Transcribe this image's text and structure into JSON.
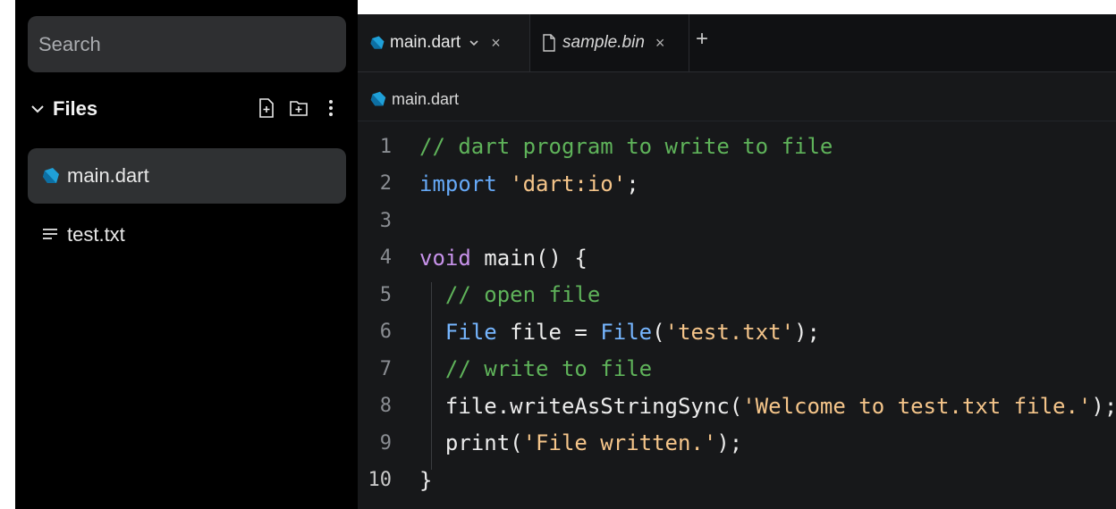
{
  "colors": {
    "sidebar_bg": "#000000",
    "editor_bg": "#17181a",
    "dart_icon": "#1fa0d8",
    "comment": "#5fb35a",
    "keyword": "#c792ea",
    "string": "#f5c58a",
    "type": "#76b6ff"
  },
  "sidebar": {
    "search_placeholder": "Search",
    "files_title": "Files",
    "actions": [
      "new-file-icon",
      "new-folder-icon",
      "more-vertical-icon"
    ],
    "files": [
      {
        "name": "main.dart",
        "icon": "dart-icon",
        "active": true
      },
      {
        "name": "test.txt",
        "icon": "text-file-icon",
        "active": false
      }
    ]
  },
  "tabs": [
    {
      "label": "main.dart",
      "icon": "dart-icon",
      "active": true,
      "close": "×"
    },
    {
      "label": "sample.bin",
      "icon": "file-icon",
      "active": false,
      "close": "×"
    }
  ],
  "add_tab": "+",
  "breadcrumb": {
    "label": "main.dart",
    "icon": "dart-icon"
  },
  "code": {
    "line_numbers": [
      "1",
      "2",
      "3",
      "4",
      "5",
      "6",
      "7",
      "8",
      "9",
      "10"
    ],
    "lines": [
      [
        {
          "t": "// dart program to write to file",
          "c": "comment"
        }
      ],
      [
        {
          "t": "import ",
          "c": "import"
        },
        {
          "t": "'dart:io'",
          "c": "str"
        },
        {
          "t": ";",
          "c": "plain"
        }
      ],
      [],
      [
        {
          "t": "void ",
          "c": "kw"
        },
        {
          "t": "main() {",
          "c": "plain"
        }
      ],
      [
        {
          "t": "  // open file",
          "c": "comment"
        }
      ],
      [
        {
          "t": "  ",
          "c": "plain"
        },
        {
          "t": "File ",
          "c": "type"
        },
        {
          "t": "file = ",
          "c": "plain"
        },
        {
          "t": "File",
          "c": "type"
        },
        {
          "t": "(",
          "c": "plain"
        },
        {
          "t": "'test.txt'",
          "c": "str"
        },
        {
          "t": ");",
          "c": "plain"
        }
      ],
      [
        {
          "t": "  // write to file",
          "c": "comment"
        }
      ],
      [
        {
          "t": "  file.writeAsStringSync(",
          "c": "plain"
        },
        {
          "t": "'Welcome to test.txt file.'",
          "c": "str"
        },
        {
          "t": ");",
          "c": "plain"
        }
      ],
      [
        {
          "t": "  print(",
          "c": "plain"
        },
        {
          "t": "'File written.'",
          "c": "str"
        },
        {
          "t": ");",
          "c": "plain"
        }
      ],
      [
        {
          "t": "}",
          "c": "plain"
        }
      ]
    ]
  }
}
